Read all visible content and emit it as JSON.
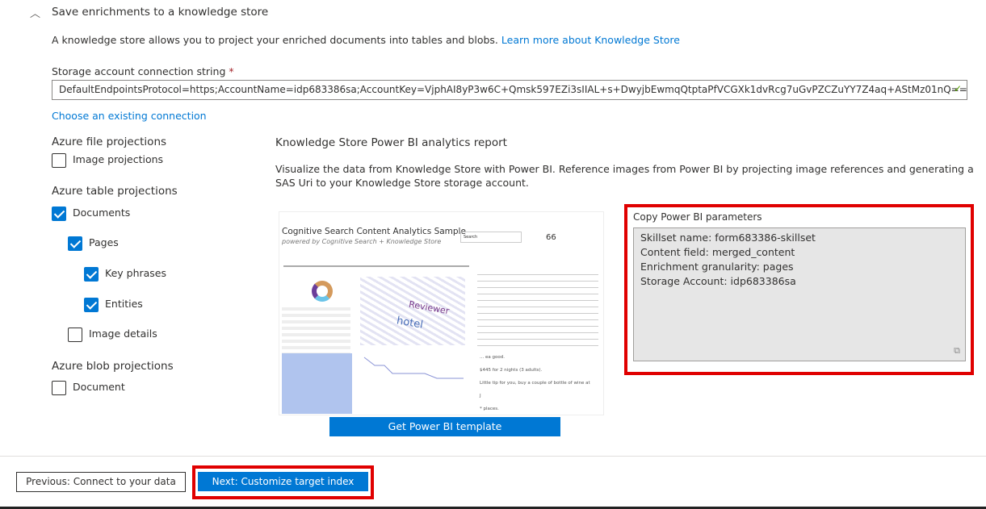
{
  "section": {
    "title": "Save enrichments to a knowledge store",
    "description": "A knowledge store allows you to project your enriched documents into tables and blobs.",
    "learn_more": "Learn more about Knowledge Store"
  },
  "connection": {
    "label": "Storage account connection string",
    "required_mark": "*",
    "value": "DefaultEndpointsProtocol=https;AccountName=idp683386sa;AccountKey=VjphAI8yP3w6C+Qmsk597EZi3sIIAL+s+DwyjbEwmqQtptaPfVCGXk1dvRcg7uGvPZCZuYY7Z4aq+AStMz01nQ==;E...",
    "choose_existing": "Choose an existing connection"
  },
  "projections": {
    "file_heading": "Azure file projections",
    "image_projections": "Image projections",
    "table_heading": "Azure table projections",
    "documents": "Documents",
    "pages": "Pages",
    "key_phrases": "Key phrases",
    "entities": "Entities",
    "image_details": "Image details",
    "blob_heading": "Azure blob projections",
    "document": "Document"
  },
  "powerbi": {
    "title": "Knowledge Store Power BI analytics report",
    "description": "Visualize the data from Knowledge Store with Power BI. Reference images from Power BI by projecting image references and generating a SAS Uri to your Knowledge Store storage account.",
    "preview": {
      "title": "Cognitive Search Content Analytics Sample",
      "subtitle": "powered by Cognitive Search + Knowledge Store",
      "search": "Search",
      "total": "66",
      "words": [
        "Reviewer",
        "hotel"
      ],
      "snippets": [
        "... ea good.",
        "$445 for 2 nights (3 adults).",
        "Little tip for you, buy a couple of bottle of wine at",
        "J",
        "* places."
      ]
    },
    "template_button": "Get Power BI template",
    "params_label": "Copy Power BI parameters",
    "params": [
      "Skillset name: form683386-skillset",
      "Content field: merged_content",
      "Enrichment granularity: pages",
      "Storage Account: idp683386sa"
    ]
  },
  "footer": {
    "previous": "Previous: Connect to your data",
    "next": "Next: Customize target index"
  },
  "colors": {
    "accent": "#0078d4",
    "highlight": "#e00000",
    "valid": "#57a300"
  }
}
